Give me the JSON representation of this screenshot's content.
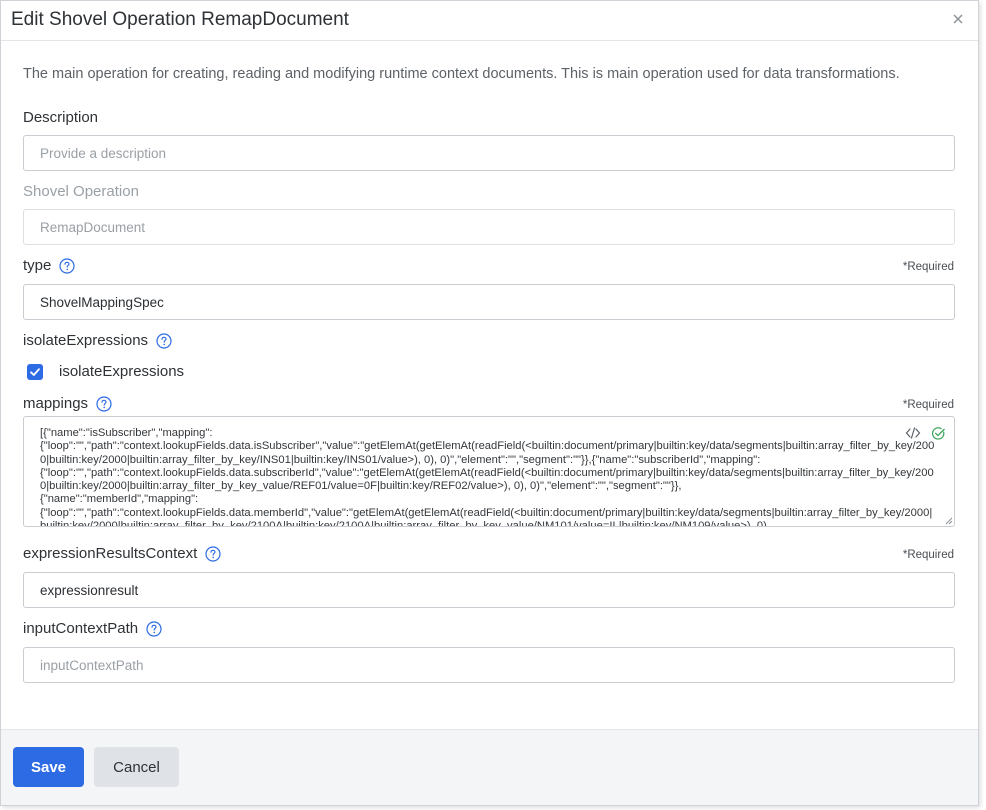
{
  "dialog": {
    "title": "Edit Shovel Operation RemapDocument",
    "intro": "The main operation for creating, reading and modifying runtime context documents. This is main operation used for data transformations."
  },
  "fields": {
    "description": {
      "label": "Description",
      "placeholder": "Provide a description",
      "value": ""
    },
    "shovel_operation": {
      "label": "Shovel Operation",
      "value": "RemapDocument"
    },
    "type": {
      "label": "type",
      "required": "*Required",
      "value": "ShovelMappingSpec"
    },
    "isolate_expressions": {
      "label": "isolateExpressions",
      "checkbox_label": "isolateExpressions",
      "checked": true
    },
    "mappings": {
      "label": "mappings",
      "required": "*Required",
      "value": "[{\"name\":\"isSubscriber\",\"mapping\":\n{\"loop\":\"\",\"path\":\"context.lookupFields.data.isSubscriber\",\"value\":\"getElemAt(getElemAt(readField(<builtin:document/primary|builtin:key/data/segments|builtin:array_filter_by_key/2000|builtin:key/2000|builtin:array_filter_by_key/INS01|builtin:key/INS01/value>), 0), 0)\",\"element\":\"\",\"segment\":\"\"}},{\"name\":\"subscriberId\",\"mapping\":\n{\"loop\":\"\",\"path\":\"context.lookupFields.data.subscriberId\",\"value\":\"getElemAt(getElemAt(readField(<builtin:document/primary|builtin:key/data/segments|builtin:array_filter_by_key/2000|builtin:key/2000|builtin:array_filter_by_key_value/REF01/value=0F|builtin:key/REF02/value>), 0), 0)\",\"element\":\"\",\"segment\":\"\"}},\n{\"name\":\"memberId\",\"mapping\":\n{\"loop\":\"\",\"path\":\"context.lookupFields.data.memberId\",\"value\":\"getElemAt(getElemAt(readField(<builtin:document/primary|builtin:key/data/segments|builtin:array_filter_by_key/2000|builtin:key/2000|builtin:array_filter_by_key/2100A|builtin:key/2100A|builtin:array_filter_by_key_value/NM101/value=IL|builtin:key/NM109/value>), 0)"
    },
    "expression_results_context": {
      "label": "expressionResultsContext",
      "required": "*Required",
      "value": "expressionresult"
    },
    "input_context_path": {
      "label": "inputContextPath",
      "placeholder": "inputContextPath",
      "value": ""
    }
  },
  "footer": {
    "save_label": "Save",
    "cancel_label": "Cancel"
  },
  "icons": {
    "close": "close-icon",
    "help": "help-circle-icon",
    "code": "code-icon",
    "valid": "check-circle-icon",
    "checkbox": "checkmark-icon"
  },
  "colors": {
    "accent": "#2d6be4",
    "valid": "#3aa35a"
  }
}
